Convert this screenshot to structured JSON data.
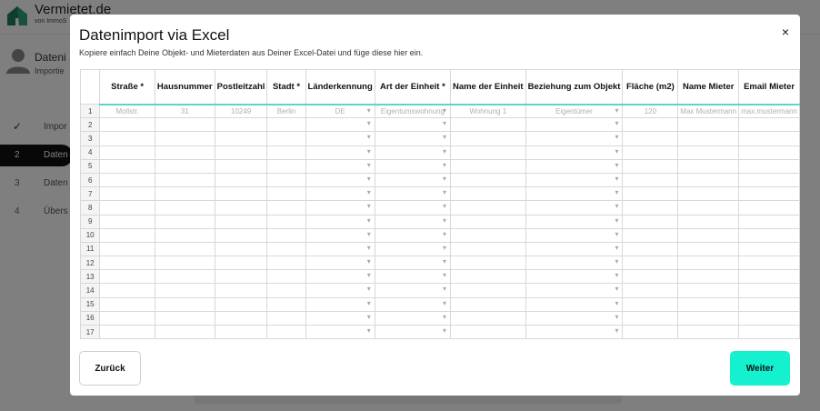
{
  "app": {
    "brand": "Vermietet.de",
    "brand_sub": "von ImmoS",
    "user_name": "Dateni",
    "user_sub": "Importie",
    "steps": [
      {
        "num": "",
        "label": "Impor"
      },
      {
        "num": "2",
        "label": "Daten"
      },
      {
        "num": "3",
        "label": "Daten"
      },
      {
        "num": "4",
        "label": "Übers"
      }
    ]
  },
  "modal": {
    "title": "Datenimport via Excel",
    "subtitle": "Kopiere einfach Deine Objekt- und Mieterdaten aus Deiner Excel-Datei und füge diese hier ein.",
    "close": "×",
    "columns": [
      "Straße *",
      "Hausnummer",
      "Postleitzahl",
      "Stadt *",
      "Länderkennung",
      "Art der Einheit *",
      "Name der Einheit",
      "Beziehung zum Objekt",
      "Fläche (m2)",
      "Name Mieter",
      "Email Mieter"
    ],
    "example_row": [
      "Mollstr.",
      "31",
      "10249",
      "Berlin",
      "DE",
      "Eigentumswohnung",
      "Wohnung 1",
      "Eigentümer",
      "120",
      "Max Mustermann",
      "max.mustermann"
    ],
    "row_numbers": [
      "1",
      "2",
      "3",
      "4",
      "5",
      "6",
      "7",
      "8",
      "9",
      "10",
      "11",
      "12",
      "13",
      "14",
      "15",
      "16",
      "17"
    ],
    "back_label": "Zurück",
    "next_label": "Weiter"
  },
  "colors": {
    "accent": "#15f0cf",
    "header_underline": "#5ad5c8"
  }
}
